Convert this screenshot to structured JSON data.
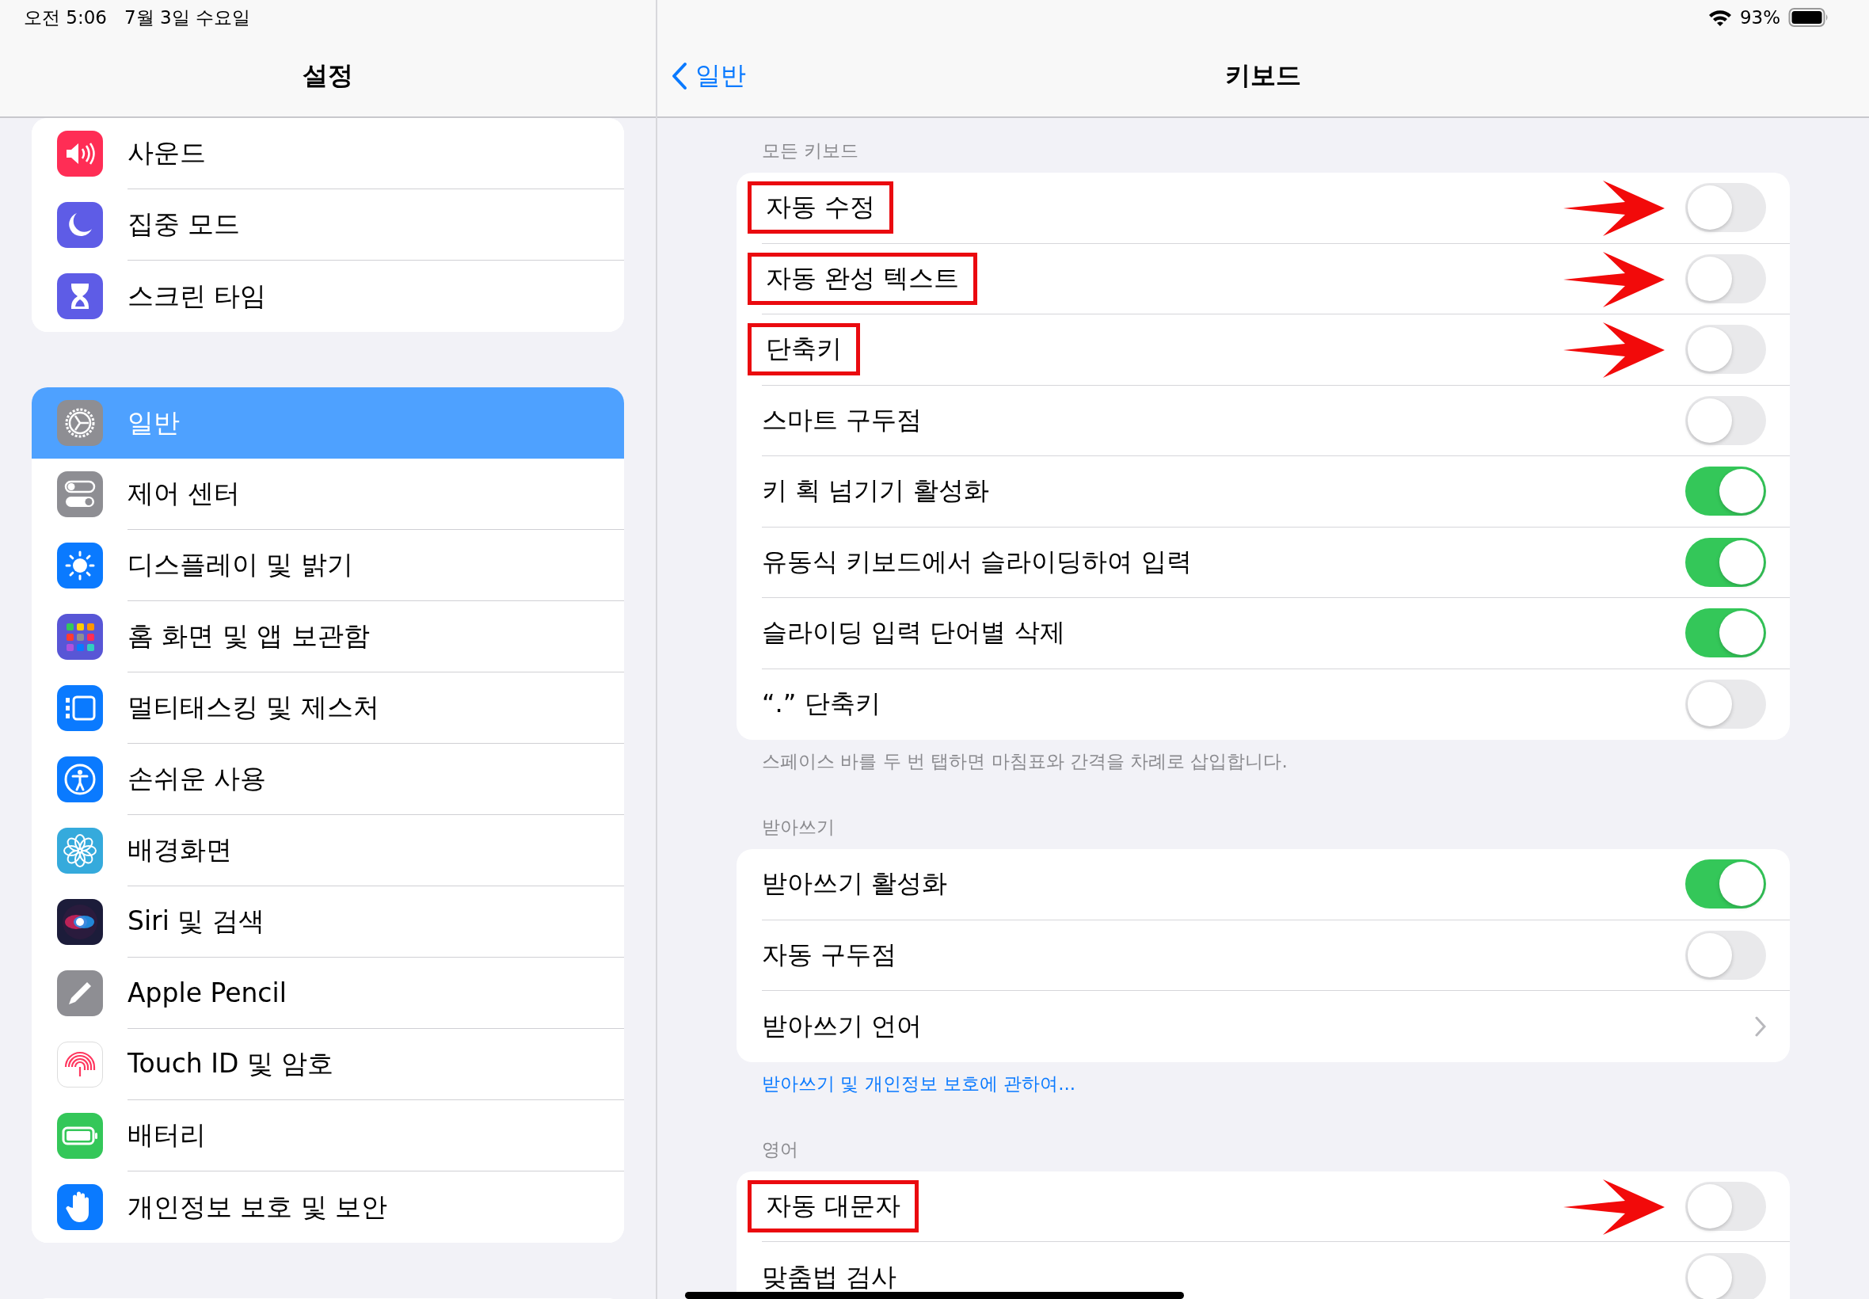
{
  "status_bar": {
    "time": "오전 5:06",
    "date": "7월 3일 수요일",
    "battery": "93%"
  },
  "sidebar": {
    "title": "설정",
    "groups": [
      {
        "items": [
          {
            "label": "사운드",
            "selected": false
          },
          {
            "label": "집중 모드",
            "selected": false
          },
          {
            "label": "스크린 타임",
            "selected": false
          }
        ]
      },
      {
        "items": [
          {
            "label": "일반",
            "selected": true
          },
          {
            "label": "제어 센터",
            "selected": false
          },
          {
            "label": "디스플레이 및 밝기",
            "selected": false
          },
          {
            "label": "홈 화면 및 앱 보관함",
            "selected": false
          },
          {
            "label": "멀티태스킹 및 제스처",
            "selected": false
          },
          {
            "label": "손쉬운 사용",
            "selected": false
          },
          {
            "label": "배경화면",
            "selected": false
          },
          {
            "label": "Siri 및 검색",
            "selected": false
          },
          {
            "label": "Apple Pencil",
            "selected": false
          },
          {
            "label": "Touch ID 및 암호",
            "selected": false
          },
          {
            "label": "배터리",
            "selected": false
          },
          {
            "label": "개인정보 보호 및 보안",
            "selected": false
          }
        ]
      }
    ]
  },
  "detail": {
    "back": "일반",
    "title": "키보드",
    "sections": [
      {
        "header": "모든 키보드",
        "rows": [
          {
            "label": "자동 수정",
            "kind": "toggle",
            "on": false,
            "highlighted": true
          },
          {
            "label": "자동 완성 텍스트",
            "kind": "toggle",
            "on": false,
            "highlighted": true
          },
          {
            "label": "단축키",
            "kind": "toggle",
            "on": false,
            "highlighted": true
          },
          {
            "label": "스마트 구두점",
            "kind": "toggle",
            "on": false,
            "highlighted": false
          },
          {
            "label": "키 획 넘기기 활성화",
            "kind": "toggle",
            "on": true,
            "highlighted": false
          },
          {
            "label": "유동식 키보드에서 슬라이딩하여 입력",
            "kind": "toggle",
            "on": true,
            "highlighted": false
          },
          {
            "label": "슬라이딩 입력 단어별 삭제",
            "kind": "toggle",
            "on": true,
            "highlighted": false
          },
          {
            "label": "“.” 단축키",
            "kind": "toggle",
            "on": false,
            "highlighted": false
          }
        ],
        "footer": "스페이스 바를 두 번 탭하면 마침표와 간격을 차례로 삽입합니다."
      },
      {
        "header": "받아쓰기",
        "rows": [
          {
            "label": "받아쓰기 활성화",
            "kind": "toggle",
            "on": true,
            "highlighted": false
          },
          {
            "label": "자동 구두점",
            "kind": "toggle",
            "on": false,
            "highlighted": false
          },
          {
            "label": "받아쓰기 언어",
            "kind": "chevron",
            "highlighted": false
          }
        ],
        "link": "받아쓰기 및 개인정보 보호에 관하여..."
      },
      {
        "header": "영어",
        "rows": [
          {
            "label": "자동 대문자",
            "kind": "toggle",
            "on": false,
            "highlighted": true
          },
          {
            "label": "맞춤법 검사",
            "kind": "toggle",
            "on": false,
            "highlighted": false
          }
        ]
      }
    ]
  }
}
